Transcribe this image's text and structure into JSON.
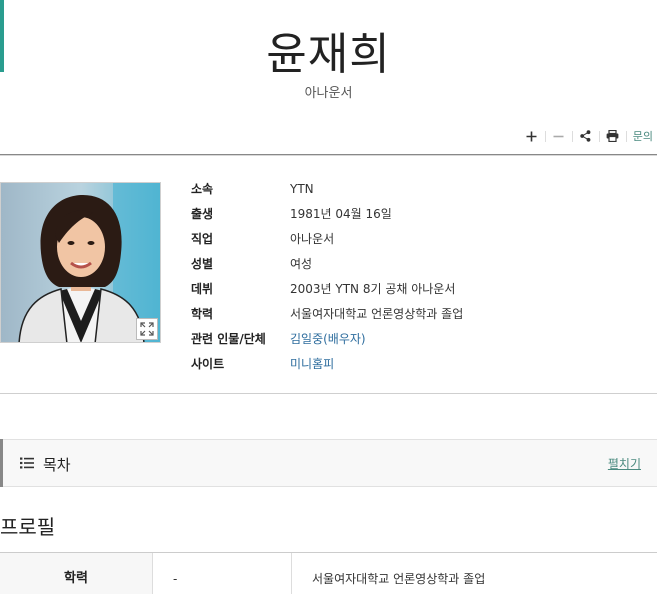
{
  "header": {
    "title": "윤재희",
    "subtitle": "아나운서"
  },
  "toolbar": {
    "icons": [
      "plus-icon",
      "minus-icon",
      "share-icon",
      "print-icon"
    ],
    "inquiry_label": "문의"
  },
  "info": {
    "rows": [
      {
        "key": "소속",
        "value": "YTN"
      },
      {
        "key": "출생",
        "value": "1981년 04월 16일"
      },
      {
        "key": "직업",
        "value": "아나운서"
      },
      {
        "key": "성별",
        "value": "여성"
      },
      {
        "key": "데뷔",
        "value": "2003년 YTN 8기 공채 아나운서"
      },
      {
        "key": "학력",
        "value": "서울여자대학교 언론영상학과 졸업"
      },
      {
        "key": "관련 인물/단체",
        "value": "김일중(배우자)"
      },
      {
        "key": "사이트",
        "value": "미니홈피"
      }
    ]
  },
  "toc": {
    "title": "목차",
    "toggle_label": "펼치기"
  },
  "profile": {
    "section_title": "프로필",
    "rows": [
      {
        "label": "학력",
        "period": "-",
        "value": "서울여자대학교 언론영상학과 졸업"
      }
    ]
  },
  "colors": {
    "accent": "#2a9d8f",
    "link": "#2e6d9e",
    "toggle": "#4a8a7f"
  }
}
